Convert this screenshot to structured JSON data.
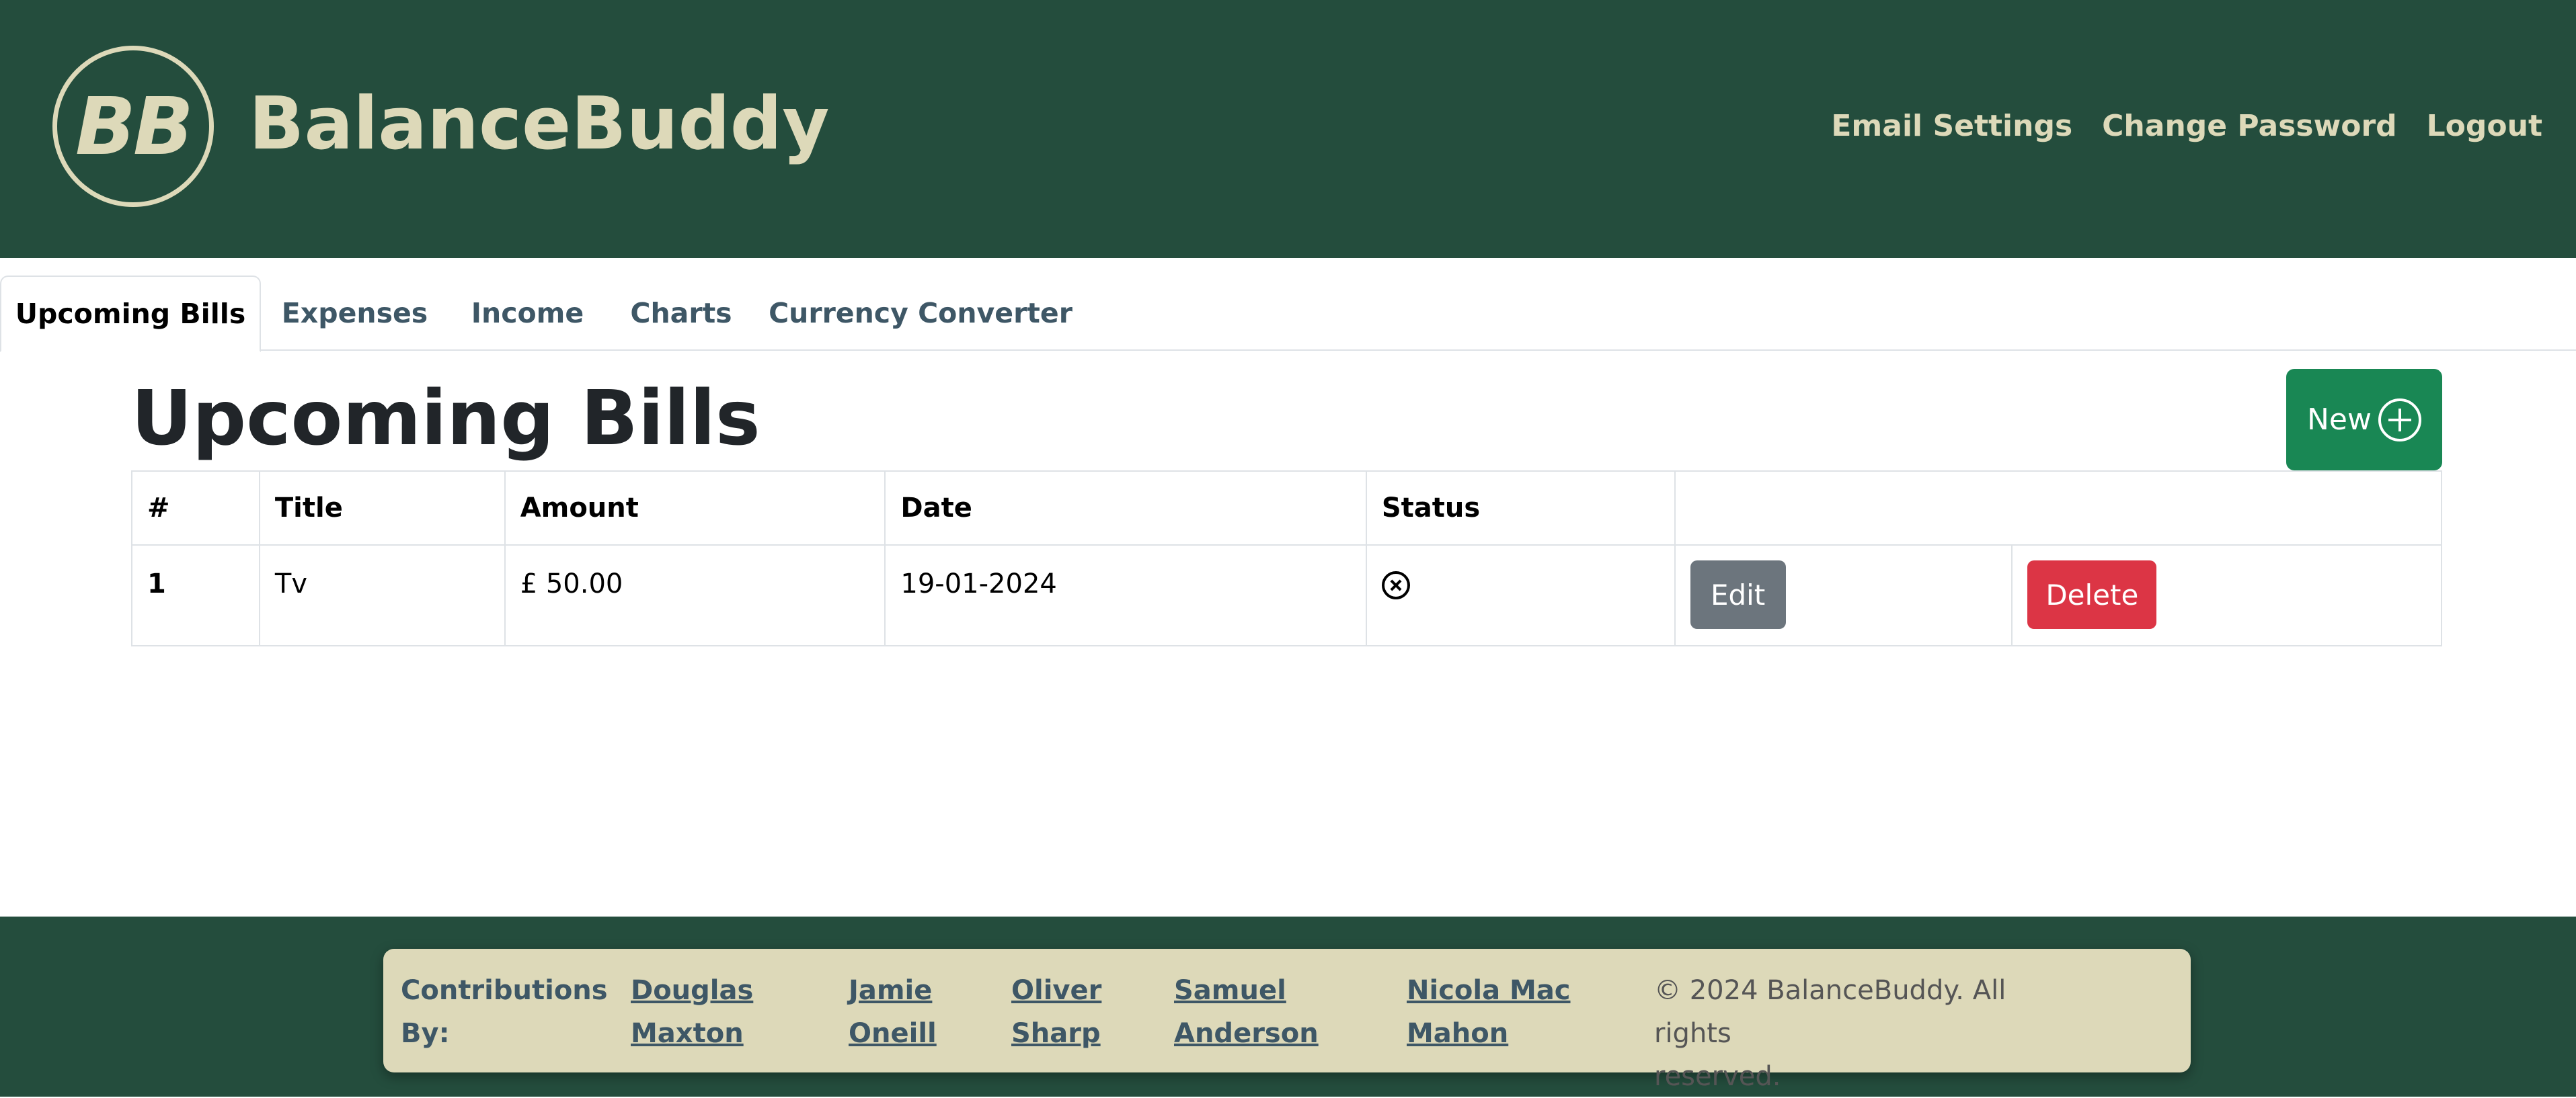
{
  "header": {
    "logo_text": "BB",
    "brand_name": "BalanceBuddy",
    "nav": [
      {
        "label": "Email Settings"
      },
      {
        "label": "Change Password"
      },
      {
        "label": "Logout"
      }
    ],
    "colors": {
      "background": "#244d3d",
      "accent": "#ddd9b9"
    }
  },
  "tabs": [
    {
      "label": "Upcoming Bills",
      "active": true
    },
    {
      "label": "Expenses",
      "active": false
    },
    {
      "label": "Income",
      "active": false
    },
    {
      "label": "Charts",
      "active": false
    },
    {
      "label": "Currency Converter",
      "active": false
    }
  ],
  "main": {
    "title": "Upcoming Bills",
    "new_button_label": "New",
    "new_button_icon": "plus-circle-icon"
  },
  "table": {
    "headers": [
      "#",
      "Title",
      "Amount",
      "Date",
      "Status",
      ""
    ],
    "rows": [
      {
        "num": "1",
        "title": "Tv",
        "amount": "£ 50.00",
        "date": "19-01-2024",
        "status_icon": "x-circle-icon",
        "edit_label": "Edit",
        "delete_label": "Delete"
      }
    ]
  },
  "footer": {
    "label_line1": "Contributions",
    "label_line2": "By:",
    "contributors": [
      {
        "line1": "Douglas",
        "line2": "Maxton"
      },
      {
        "line1": "Jamie",
        "line2": "Oneill"
      },
      {
        "line1": "Oliver",
        "line2": "Sharp"
      },
      {
        "line1": "Samuel",
        "line2": "Anderson"
      },
      {
        "line1": "Nicola Mac",
        "line2": "Mahon"
      }
    ],
    "copyright_line1": "© 2024 BalanceBuddy. All rights",
    "copyright_line2": "reserved."
  }
}
